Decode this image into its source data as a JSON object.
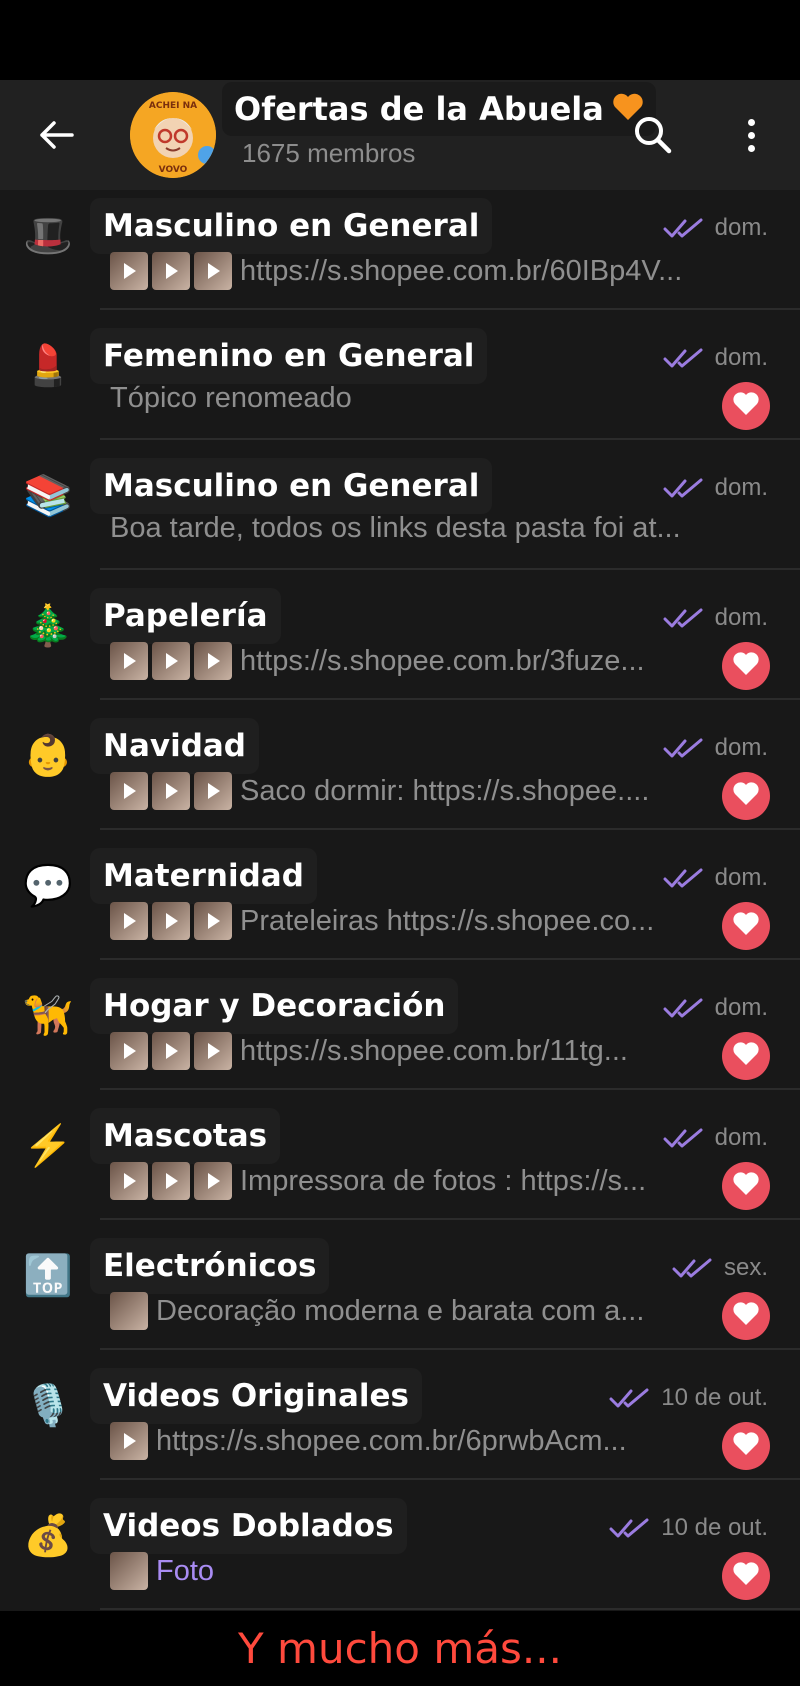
{
  "header": {
    "title": "Ofertas de la Abuela",
    "title_emoji": "🧡",
    "members": "1675 membros",
    "avatar_text_top": "ACHEI NA",
    "avatar_text_bottom": "VOVO",
    "back_icon": "arrow-left-icon",
    "search_icon": "search-icon",
    "menu_icon": "more-vertical-icon"
  },
  "colors": {
    "accent": "#9b7ce0",
    "badge": "#ea4f5e",
    "header_bg": "#212121",
    "list_bg": "#181818",
    "footer_text": "#ff4a3d"
  },
  "topics": [
    {
      "emoji": "🎩",
      "name": "Masculino en General",
      "date": "dom.",
      "thumbs": 3,
      "thumb_play": true,
      "preview": "https://s.shopee.com.br/60IBp4V...",
      "badge": false
    },
    {
      "emoji": "💄",
      "name": "Femenino en General",
      "date": "dom.",
      "thumbs": 0,
      "thumb_play": false,
      "preview": "Tópico renomeado",
      "badge": true
    },
    {
      "emoji": "📚",
      "name": "Masculino en General",
      "date": "dom.",
      "thumbs": 0,
      "thumb_play": false,
      "preview": "Boa tarde, todos os links desta pasta foi at...",
      "badge": false
    },
    {
      "emoji": "🎄",
      "name": "Papelería",
      "date": "dom.",
      "thumbs": 3,
      "thumb_play": true,
      "preview": "https://s.shopee.com.br/3fuze...",
      "badge": true
    },
    {
      "emoji": "👶",
      "name": "Navidad",
      "date": "dom.",
      "thumbs": 3,
      "thumb_play": true,
      "preview": "Saco dormir: https://s.shopee....",
      "badge": true
    },
    {
      "emoji": "💬",
      "name": "Maternidad",
      "date": "dom.",
      "thumbs": 3,
      "thumb_play": true,
      "preview": "Prateleiras https://s.shopee.co...",
      "badge": true
    },
    {
      "emoji": "🦮",
      "name": "Hogar y Decoración",
      "date": "dom.",
      "thumbs": 3,
      "thumb_play": true,
      "preview": "https://s.shopee.com.br/11tg...",
      "badge": true
    },
    {
      "emoji": "⚡",
      "name": "Mascotas",
      "date": "dom.",
      "thumbs": 3,
      "thumb_play": true,
      "preview": "Impressora de fotos : https://s...",
      "badge": true
    },
    {
      "emoji": "🔝",
      "name": "Electrónicos",
      "date": "sex.",
      "thumbs": 1,
      "thumb_play": false,
      "preview": "Decoração moderna e barata com a...",
      "badge": true
    },
    {
      "emoji": "🎙️",
      "name": "Videos Originales",
      "date": "10 de out.",
      "thumbs": 1,
      "thumb_play": true,
      "preview": "https://s.shopee.com.br/6prwbAcm...",
      "badge": true
    },
    {
      "emoji": "💰",
      "name": "Videos Doblados",
      "date": "10 de out.",
      "thumbs": 1,
      "thumb_play": false,
      "preview": "Foto",
      "preview_purple": true,
      "badge": true
    }
  ],
  "footer": {
    "text": "Y mucho más..."
  }
}
